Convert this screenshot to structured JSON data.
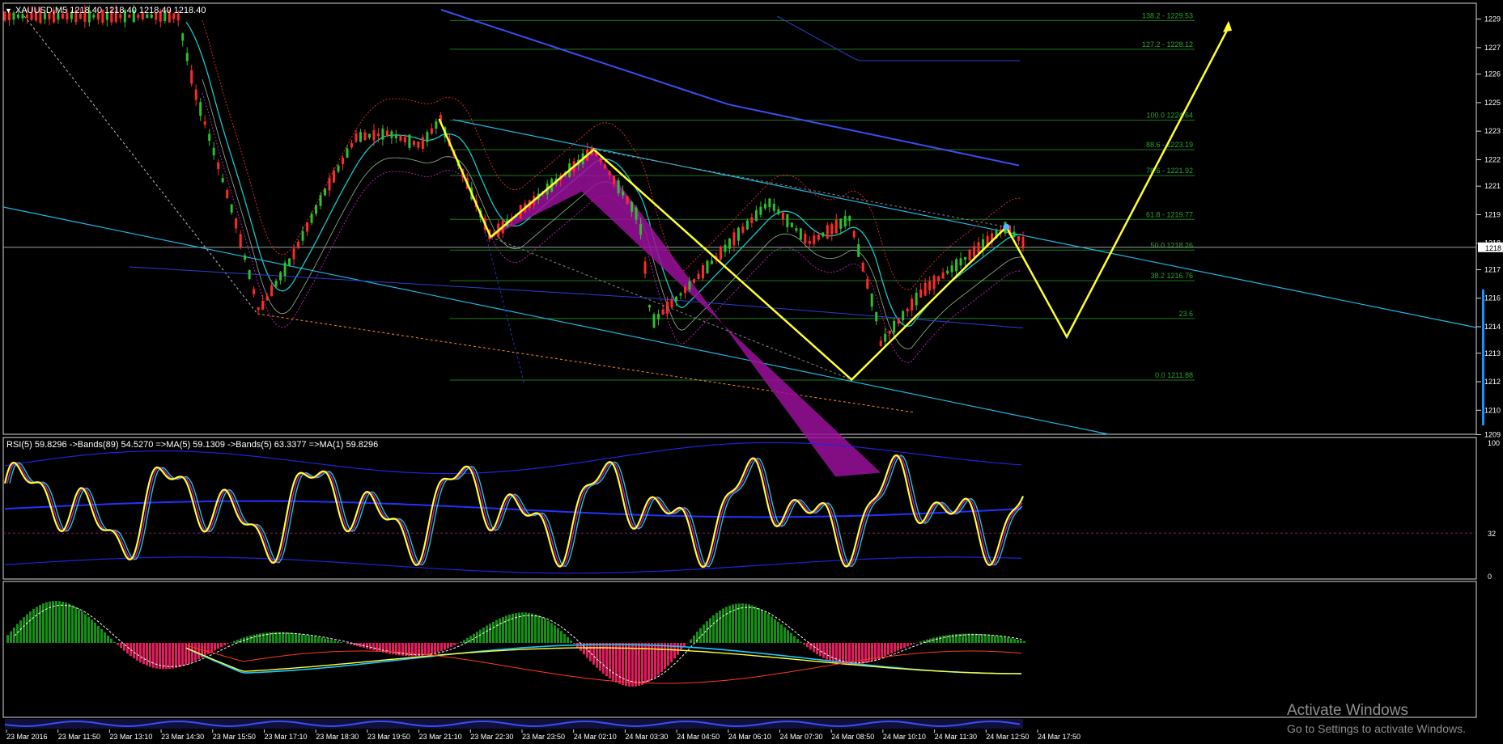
{
  "window": {
    "symbol_header": "XAUUSD,M5  1218.40 1218.40 1218.40 1218.40",
    "header_arrow": "triangle-down-icon"
  },
  "price_axis": {
    "labels": [
      "1229",
      "1227",
      "1226",
      "1225",
      "1223",
      "1222",
      "1221",
      "1219",
      "1218",
      "1217",
      "1216",
      "1214",
      "1213",
      "1212",
      "1210",
      "1209"
    ],
    "current_price_label": "1218"
  },
  "fibonacci": {
    "levels": [
      {
        "label": "138.2 - 1229.53",
        "value": 1229.53
      },
      {
        "label": "127.2 - 1228.12",
        "value": 1228.12
      },
      {
        "label": "100.0 1224.64",
        "value": 1224.64
      },
      {
        "label": "88.6 - 1223.19",
        "value": 1223.19
      },
      {
        "label": "78.6 - 1221.92",
        "value": 1221.92
      },
      {
        "label": "61.8 - 1219.77",
        "value": 1219.77
      },
      {
        "label": "50.0 1218.26",
        "value": 1218.26
      },
      {
        "label": "38.2 1216.76",
        "value": 1216.76
      },
      {
        "label": "23.6",
        "value": 1214.9
      },
      {
        "label": "0.0 1211.88",
        "value": 1211.88
      }
    ]
  },
  "rsi_panel": {
    "header": "RSI(5) 59.8296  ->Bands(89) 54.5270  =>MA(5) 59.1309  ->Bands(5) 63.3377  =>MA(1) 59.8296",
    "scale": [
      "100",
      "32",
      "0"
    ]
  },
  "time_axis": {
    "labels": [
      "23 Mar 2016",
      "23 Mar 11:50",
      "23 Mar 13:10",
      "23 Mar 14:30",
      "23 Mar 15:50",
      "23 Mar 17:10",
      "23 Mar 18:30",
      "23 Mar 19:50",
      "23 Mar 21:10",
      "23 Mar 22:30",
      "23 Mar 23:50",
      "24 Mar 02:10",
      "24 Mar 03:30",
      "24 Mar 04:50",
      "24 Mar 06:10",
      "24 Mar 07:30",
      "24 Mar 08:50",
      "24 Mar 10:10",
      "24 Mar 11:30",
      "24 Mar 12:50",
      "24 Mar 17:50"
    ]
  },
  "watermark": {
    "title": "Activate Windows",
    "subtitle": "Go to Settings to activate Windows."
  },
  "colors": {
    "background": "#000000",
    "bull_candle": "#2fbf2f",
    "bear_candle": "#ff2a2a",
    "pattern_line": "#ffff33",
    "harmonic_fill": "#9a109a",
    "fib_line": "#1e7a1e",
    "trendline": "#1fb8e6",
    "ma_blue": "#3a4ef0",
    "macd_green": "#168f16",
    "macd_red": "#e21d5e"
  },
  "chart_data": {
    "type": "candlestick",
    "title": "XAUUSD,M5",
    "ylim": [
      1209,
      1230
    ],
    "pattern_points": [
      {
        "x": "23 Mar 21:10",
        "y": 1224.7
      },
      {
        "x": "23 Mar 22:30",
        "y": 1218.9
      },
      {
        "x": "24 Mar 02:10",
        "y": 1223.2
      },
      {
        "x": "24 Mar 08:50",
        "y": 1211.9
      },
      {
        "x": "24 Mar 12:50",
        "y": 1219.4
      }
    ],
    "projection": [
      {
        "step": "down",
        "y": 1214.0
      },
      {
        "step": "up",
        "y": 1229.2
      }
    ],
    "rsi": {
      "ylim": [
        0,
        100
      ],
      "level": 32
    },
    "notes": [
      "harmonic pattern with fibonacci retracement levels",
      "RSI(5) with bands panel",
      "MACD histogram panel"
    ]
  }
}
